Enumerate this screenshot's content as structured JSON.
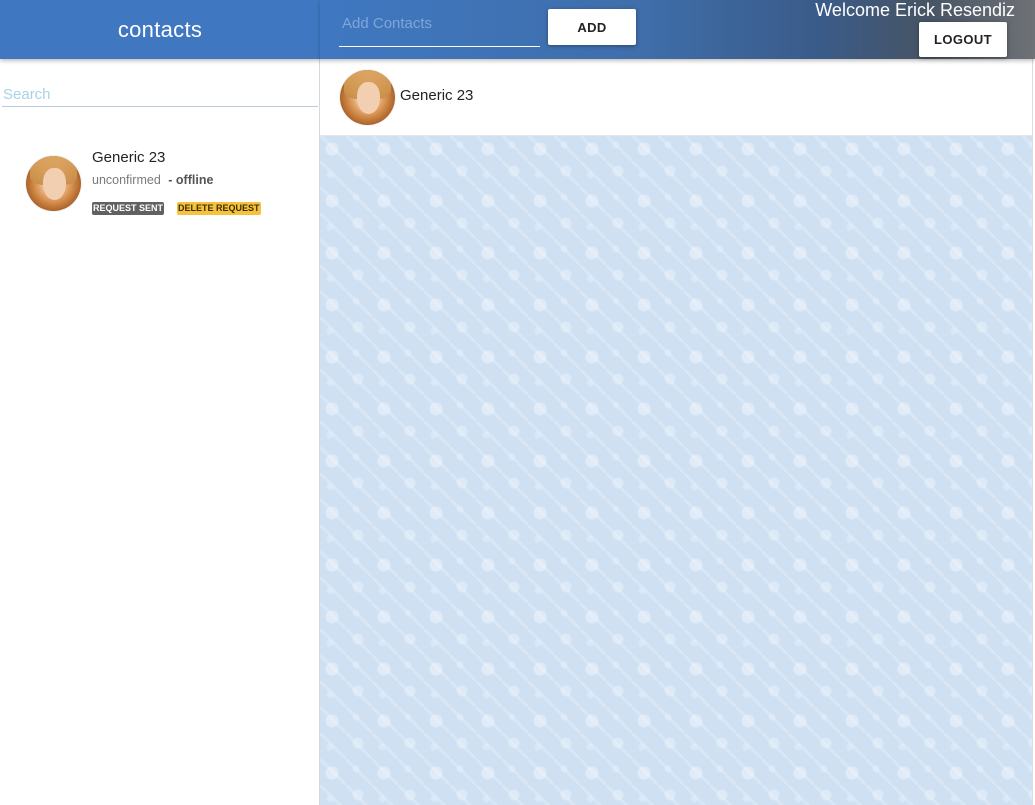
{
  "sidebar": {
    "title": "contacts",
    "search": {
      "placeholder": "Search",
      "value": ""
    },
    "contacts": [
      {
        "name": "Generic 23",
        "status": "unconfirmed",
        "presence": "- offline",
        "badges": {
          "sent": "REQUEST SENT",
          "delete": "DELETE REQUEST"
        }
      }
    ]
  },
  "header": {
    "add_contact": {
      "placeholder": "Add Contacts",
      "value": ""
    },
    "add_label": "ADD",
    "welcome": "Welcome Erick Resendiz",
    "logout_label": "LOGOUT"
  },
  "chat": {
    "contact_name": "Generic 23"
  },
  "colors": {
    "primary": "#3f78c1",
    "badge_sent": "#616161",
    "badge_delete": "#f6c23e",
    "chat_background": "#cfe0f3"
  }
}
